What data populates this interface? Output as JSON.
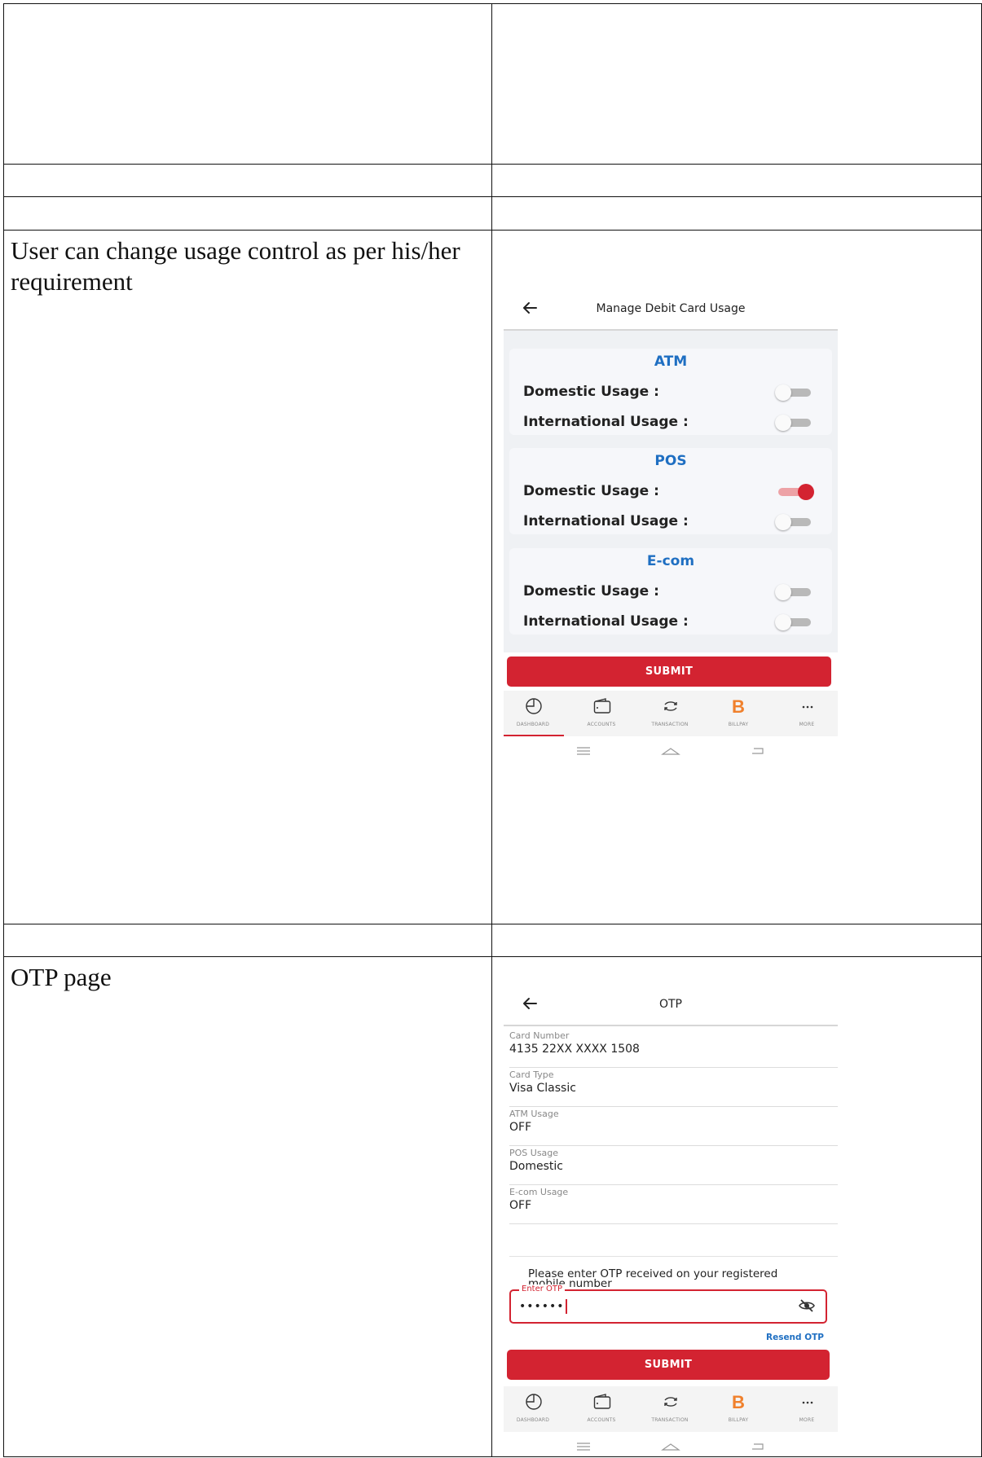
{
  "rows": [
    {
      "text": ""
    },
    {
      "text": ""
    },
    {
      "text": ""
    },
    {
      "text": "User can change usage control as per his/her requirement"
    },
    {
      "text": ""
    },
    {
      "text": "OTP page"
    }
  ],
  "manage_screen": {
    "title": "Manage Debit Card Usage",
    "back_icon": "arrow-left-icon",
    "sections": [
      {
        "title": "ATM",
        "rows": [
          {
            "label": "Domestic Usage :",
            "enabled": false
          },
          {
            "label": "International Usage :",
            "enabled": false
          }
        ]
      },
      {
        "title": "POS",
        "rows": [
          {
            "label": "Domestic Usage :",
            "enabled": true
          },
          {
            "label": "International Usage :",
            "enabled": false
          }
        ]
      },
      {
        "title": "E-com",
        "rows": [
          {
            "label": "Domestic Usage :",
            "enabled": false
          },
          {
            "label": "International Usage :",
            "enabled": false
          }
        ]
      }
    ],
    "submit_label": "SUBMIT"
  },
  "otp_screen": {
    "title": "OTP",
    "back_icon": "arrow-left-icon",
    "fields": [
      {
        "label": "Card Number",
        "value": "4135 22XX XXXX 1508"
      },
      {
        "label": "Card Type",
        "value": "Visa Classic"
      },
      {
        "label": "ATM Usage",
        "value": "OFF"
      },
      {
        "label": "POS Usage",
        "value": "Domestic"
      },
      {
        "label": "E-com Usage",
        "value": "OFF"
      }
    ],
    "prompt_line1": "Please enter OTP received on your registered",
    "prompt_line2": "mobile number",
    "otp_label": "Enter OTP",
    "otp_value": "••••••",
    "resend_label": "Resend OTP",
    "submit_label": "SUBMIT"
  },
  "bottom_nav": [
    {
      "label": "DASHBOARD",
      "icon": "dashboard-icon"
    },
    {
      "label": "ACCOUNTS",
      "icon": "wallet-icon"
    },
    {
      "label": "TRANSACTION",
      "icon": "transaction-icon"
    },
    {
      "label": "BILLPAY",
      "icon": "billpay-icon"
    },
    {
      "label": "MORE",
      "icon": "more-icon"
    }
  ],
  "accent_color": "#d32331",
  "link_color": "#1f6fc2",
  "billpay_color": "#f0802c"
}
